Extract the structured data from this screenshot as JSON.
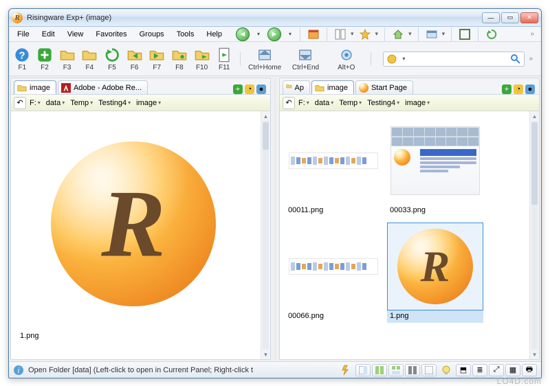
{
  "window": {
    "title": "Risingware Exp+  (image)"
  },
  "menus": [
    "File",
    "Edit",
    "View",
    "Favorites",
    "Groups",
    "Tools",
    "Help"
  ],
  "fnbar": [
    {
      "id": "F1",
      "label": "F1",
      "icon": "help",
      "color": "#3a8bd6"
    },
    {
      "id": "F2",
      "label": "F2",
      "icon": "plus",
      "color": "#3aa83a"
    },
    {
      "id": "F3",
      "label": "F3",
      "icon": "folder",
      "color": "#e8b43a"
    },
    {
      "id": "F4",
      "label": "F4",
      "icon": "folder",
      "color": "#e8b43a"
    },
    {
      "id": "F5",
      "label": "F5",
      "icon": "refresh",
      "color": "#3aa83a"
    },
    {
      "id": "F6",
      "label": "F6",
      "icon": "arrow-left",
      "color": "#3aa83a"
    },
    {
      "id": "F7",
      "label": "F7",
      "icon": "arrow-right",
      "color": "#3aa83a"
    },
    {
      "id": "F8",
      "label": "F8",
      "icon": "folder-plus",
      "color": "#3aa83a"
    },
    {
      "id": "F10",
      "label": "F10",
      "icon": "folder-go",
      "color": "#3aa83a"
    },
    {
      "id": "F11",
      "label": "F11",
      "icon": "doc-go",
      "color": "#3aa83a"
    },
    {
      "id": "CtrlHome",
      "label": "Ctrl+Home",
      "icon": "home",
      "color": "#3a8bd6",
      "wide": true
    },
    {
      "id": "CtrlEnd",
      "label": "Ctrl+End",
      "icon": "end",
      "color": "#3a8bd6",
      "wide": true
    },
    {
      "id": "AltO",
      "label": "Alt+O",
      "icon": "gear",
      "color": "#4e8ec9",
      "wide": true
    }
  ],
  "search": {
    "placeholder": ""
  },
  "left": {
    "tabs": [
      {
        "label": "image",
        "icon": "folder",
        "active": true
      },
      {
        "label": "Adobe - Adobe Re...",
        "icon": "adobe",
        "active": false
      }
    ],
    "crumbs": [
      "F:",
      "data",
      "Temp",
      "Testing4",
      "image"
    ],
    "item": {
      "name": "1.png"
    }
  },
  "right": {
    "tabs": [
      {
        "label": "Ap",
        "icon": "folder",
        "active": false
      },
      {
        "label": "image",
        "icon": "folder",
        "active": true
      },
      {
        "label": "Start Page",
        "icon": "globe",
        "active": false
      }
    ],
    "crumbs": [
      "F:",
      "data",
      "Temp",
      "Testing4",
      "image"
    ],
    "items": [
      {
        "name": "00011.png",
        "kind": "ribbon"
      },
      {
        "name": "00033.png",
        "kind": "shot"
      },
      {
        "name": "00066.png",
        "kind": "ribbon"
      },
      {
        "name": "1.png",
        "kind": "globe",
        "selected": true
      }
    ]
  },
  "status": {
    "text": "Open Folder [data] (Left-click to open in Current Panel; Right-click t"
  },
  "watermark": "LO4D.com"
}
